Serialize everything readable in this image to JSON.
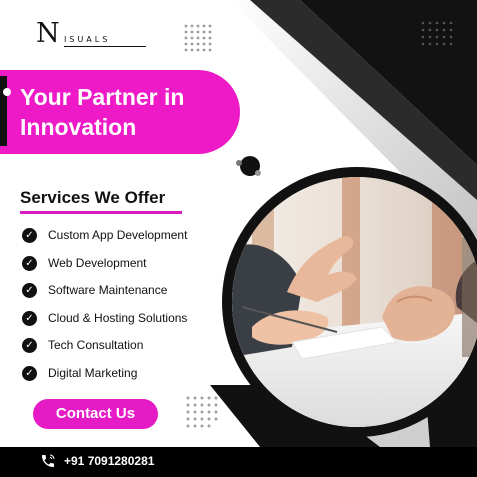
{
  "brand": {
    "logo_mark": "N",
    "logo_text": "ISUALS"
  },
  "headline": {
    "line1": "Your Partner in",
    "line2": "Innovation"
  },
  "services": {
    "title": "Services We Offer",
    "items": [
      "Custom App Development",
      "Web Development",
      "Software Maintenance",
      "Cloud & Hosting Solutions",
      "Tech Consultation",
      "Digital Marketing"
    ]
  },
  "cta": {
    "label": "Contact Us"
  },
  "contact": {
    "phone": "+91 7091280281"
  },
  "colors": {
    "accent": "#ee1ac8",
    "dark": "#111111",
    "background": "#ffffff"
  },
  "icons": {
    "check": "check-circle-icon",
    "phone": "phone-icon"
  }
}
